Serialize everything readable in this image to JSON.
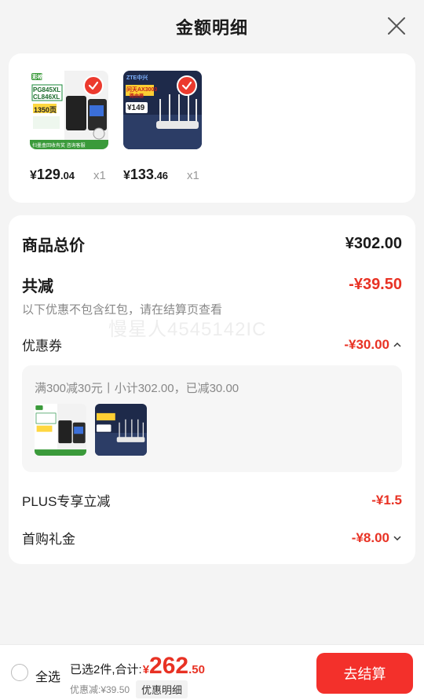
{
  "header": {
    "title": "金额明细"
  },
  "products": [
    {
      "price_currency": "¥",
      "price_int": "129",
      "price_dec": ".04",
      "qty": "x1",
      "thumb_text": {
        "brand": "彩格",
        "model1": "PG845XL",
        "model2": "CL846XL",
        "count": "1350页",
        "bottom": "扫墨盒回收有奖 咨询客服"
      }
    },
    {
      "price_currency": "¥",
      "price_int": "133",
      "price_dec": ".46",
      "qty": "x1",
      "thumb_text": {
        "brand": "ZTE中兴",
        "model": "问天AX3000",
        "sub": "路由器",
        "price": "¥149"
      }
    }
  ],
  "summary": {
    "total_label": "商品总价",
    "total_value": "¥302.00",
    "discount_label": "共减",
    "discount_value": "-¥39.50",
    "note": "以下优惠不包含红包，请在结算页查看",
    "watermark": "慢星人4545142IC",
    "coupon_label": "优惠券",
    "coupon_value": "-¥30.00",
    "coupon_desc": "满300减30元丨小计302.00，已减30.00",
    "plus_label": "PLUS专享立减",
    "plus_value": "-¥1.5",
    "first_label": "首购礼金",
    "first_value": "-¥8.00"
  },
  "bottom": {
    "select_all": "全选",
    "selected_text": "已选2件,合计:",
    "total_currency": "¥",
    "total_int": "262",
    "total_dec": ".50",
    "discount_text": "优惠减:¥39.50",
    "detail_button": "优惠明细",
    "checkout_button": "去结算"
  },
  "colors": {
    "accent": "#e83224",
    "button": "#f3302b"
  },
  "icons": [
    "close-icon",
    "check-icon",
    "chevron-up-icon",
    "chevron-down-icon"
  ]
}
